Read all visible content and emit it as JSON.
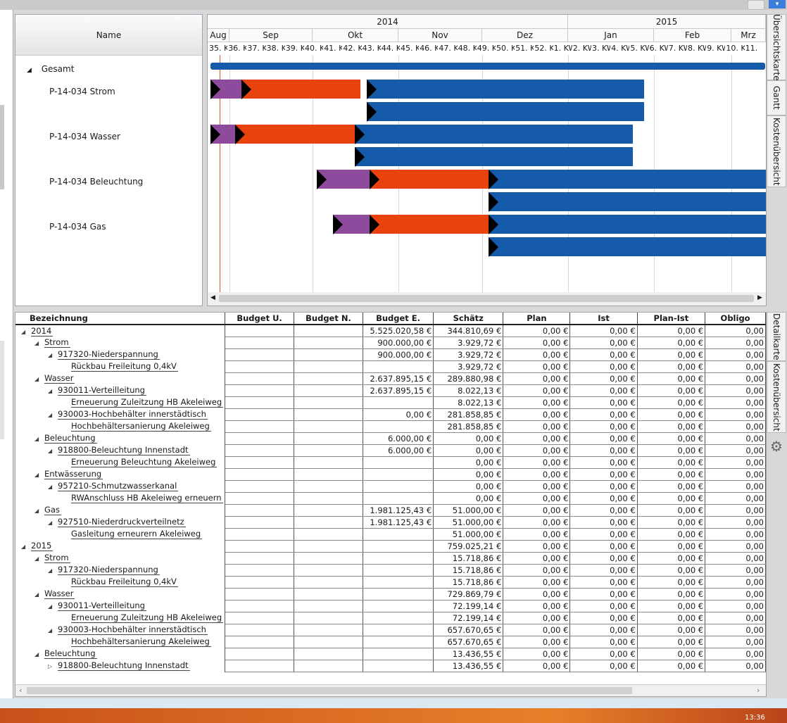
{
  "gantt": {
    "name_header": "Name",
    "years": [
      "2014",
      "2015"
    ],
    "months": [
      "Aug",
      "Sep",
      "Okt",
      "Nov",
      "Dez",
      "Jan",
      "Feb",
      "Mrz"
    ],
    "weeks": [
      "35. K",
      "36. K",
      "37. K",
      "38. K",
      "39. K",
      "40. K",
      "41. K",
      "42. K",
      "43. K",
      "44. K",
      "45. K",
      "46. K",
      "47. K",
      "48. K",
      "49. K",
      "50. K",
      "51. K",
      "52. K",
      "1. KW",
      "2. KW",
      "3. KW",
      "4. KW",
      "5. KW",
      "6. KW",
      "7. KW",
      "8. KW",
      "9. KW",
      "10. K",
      "11."
    ],
    "tree": [
      {
        "label": "Gesamt"
      },
      {
        "label": "P-14-034 Strom"
      },
      {
        "label": "P-14-034 Wasser"
      },
      {
        "label": "P-14-034 Beleuchtung"
      },
      {
        "label": "P-14-034 Gas"
      }
    ],
    "colors": {
      "purple": "#8e4a9d",
      "orange": "#e8420e",
      "blue": "#165aaa",
      "today": "#e05a10"
    }
  },
  "side_tabs_top": [
    "Übersichtskarte",
    "Gantt",
    "Kostenübersicht"
  ],
  "side_tabs_bottom": [
    "Detailkarte",
    "Kostenübersicht"
  ],
  "table": {
    "columns": [
      "Bezeichnung",
      "Budget U.",
      "Budget N.",
      "Budget E.",
      "Schätz",
      "Plan",
      "Ist",
      "Plan-Ist",
      "Obligo"
    ],
    "rows": [
      {
        "level": 0,
        "label": "2014",
        "arrow": "◢",
        "bu": "",
        "bn": "",
        "be": "5.525.020,58 €",
        "s": "344.810,69 €",
        "p": "0,00 €",
        "i": "0,00 €",
        "pi": "0,00 €",
        "o": "0,00"
      },
      {
        "level": 1,
        "label": "Strom",
        "arrow": "◢",
        "bu": "",
        "bn": "",
        "be": "900.000,00 €",
        "s": "3.929,72 €",
        "p": "0,00 €",
        "i": "0,00 €",
        "pi": "0,00 €",
        "o": "0,00"
      },
      {
        "level": 2,
        "label": "917320-Niederspannung",
        "arrow": "◢",
        "bu": "",
        "bn": "",
        "be": "900.000,00 €",
        "s": "3.929,72 €",
        "p": "0,00 €",
        "i": "0,00 €",
        "pi": "0,00 €",
        "o": "0,00"
      },
      {
        "level": 3,
        "label": "Rückbau Freileitung 0,4kV",
        "arrow": "",
        "bu": "",
        "bn": "",
        "be": "",
        "s": "3.929,72 €",
        "p": "0,00 €",
        "i": "0,00 €",
        "pi": "0,00 €",
        "o": "0,00"
      },
      {
        "level": 1,
        "label": "Wasser",
        "arrow": "◢",
        "bu": "",
        "bn": "",
        "be": "2.637.895,15 €",
        "s": "289.880,98 €",
        "p": "0,00 €",
        "i": "0,00 €",
        "pi": "0,00 €",
        "o": "0,00"
      },
      {
        "level": 2,
        "label": "930011-Verteilleitung",
        "arrow": "◢",
        "bu": "",
        "bn": "",
        "be": "2.637.895,15 €",
        "s": "8.022,13 €",
        "p": "0,00 €",
        "i": "0,00 €",
        "pi": "0,00 €",
        "o": "0,00"
      },
      {
        "level": 3,
        "label": "Erneuerung Zuleitzung HB Akeleiweg",
        "arrow": "",
        "bu": "",
        "bn": "",
        "be": "",
        "s": "8.022,13 €",
        "p": "0,00 €",
        "i": "0,00 €",
        "pi": "0,00 €",
        "o": "0,00"
      },
      {
        "level": 2,
        "label": "930003-Hochbehälter innerstädtisch",
        "arrow": "◢",
        "bu": "",
        "bn": "",
        "be": "0,00 €",
        "s": "281.858,85 €",
        "p": "0,00 €",
        "i": "0,00 €",
        "pi": "0,00 €",
        "o": "0,00"
      },
      {
        "level": 3,
        "label": "Hochbehältersanierung Akeleiweg",
        "arrow": "",
        "bu": "",
        "bn": "",
        "be": "",
        "s": "281.858,85 €",
        "p": "0,00 €",
        "i": "0,00 €",
        "pi": "0,00 €",
        "o": "0,00"
      },
      {
        "level": 1,
        "label": "Beleuchtung",
        "arrow": "◢",
        "bu": "",
        "bn": "",
        "be": "6.000,00 €",
        "s": "0,00 €",
        "p": "0,00 €",
        "i": "0,00 €",
        "pi": "0,00 €",
        "o": "0,00"
      },
      {
        "level": 2,
        "label": "918800-Beleuchtung Innenstadt",
        "arrow": "◢",
        "bu": "",
        "bn": "",
        "be": "6.000,00 €",
        "s": "0,00 €",
        "p": "0,00 €",
        "i": "0,00 €",
        "pi": "0,00 €",
        "o": "0,00"
      },
      {
        "level": 3,
        "label": "Erneuerung Beleuchtung Akeleiweg",
        "arrow": "",
        "bu": "",
        "bn": "",
        "be": "",
        "s": "0,00 €",
        "p": "0,00 €",
        "i": "0,00 €",
        "pi": "0,00 €",
        "o": "0,00"
      },
      {
        "level": 1,
        "label": "Entwässerung",
        "arrow": "◢",
        "bu": "",
        "bn": "",
        "be": "",
        "s": "0,00 €",
        "p": "0,00 €",
        "i": "0,00 €",
        "pi": "0,00 €",
        "o": "0,00"
      },
      {
        "level": 2,
        "label": "957210-Schmutzwasserkanal",
        "arrow": "◢",
        "bu": "",
        "bn": "",
        "be": "",
        "s": "0,00 €",
        "p": "0,00 €",
        "i": "0,00 €",
        "pi": "0,00 €",
        "o": "0,00"
      },
      {
        "level": 3,
        "label": "RWAnschluss HB Akeleiweg erneuern",
        "arrow": "",
        "bu": "",
        "bn": "",
        "be": "",
        "s": "0,00 €",
        "p": "0,00 €",
        "i": "0,00 €",
        "pi": "0,00 €",
        "o": "0,00"
      },
      {
        "level": 1,
        "label": "Gas",
        "arrow": "◢",
        "bu": "",
        "bn": "",
        "be": "1.981.125,43 €",
        "s": "51.000,00 €",
        "p": "0,00 €",
        "i": "0,00 €",
        "pi": "0,00 €",
        "o": "0,00"
      },
      {
        "level": 2,
        "label": "927510-Niederdruckverteilnetz",
        "arrow": "◢",
        "bu": "",
        "bn": "",
        "be": "1.981.125,43 €",
        "s": "51.000,00 €",
        "p": "0,00 €",
        "i": "0,00 €",
        "pi": "0,00 €",
        "o": "0,00"
      },
      {
        "level": 3,
        "label": "Gasleitung erneurern Akeleiweg",
        "arrow": "",
        "bu": "",
        "bn": "",
        "be": "",
        "s": "51.000,00 €",
        "p": "0,00 €",
        "i": "0,00 €",
        "pi": "0,00 €",
        "o": "0,00"
      },
      {
        "level": 0,
        "label": "2015",
        "arrow": "◢",
        "bu": "",
        "bn": "",
        "be": "",
        "s": "759.025,21 €",
        "p": "0,00 €",
        "i": "0,00 €",
        "pi": "0,00 €",
        "o": "0,00"
      },
      {
        "level": 1,
        "label": "Strom",
        "arrow": "◢",
        "bu": "",
        "bn": "",
        "be": "",
        "s": "15.718,86 €",
        "p": "0,00 €",
        "i": "0,00 €",
        "pi": "0,00 €",
        "o": "0,00"
      },
      {
        "level": 2,
        "label": "917320-Niederspannung",
        "arrow": "◢",
        "bu": "",
        "bn": "",
        "be": "",
        "s": "15.718,86 €",
        "p": "0,00 €",
        "i": "0,00 €",
        "pi": "0,00 €",
        "o": "0,00"
      },
      {
        "level": 3,
        "label": "Rückbau Freileitung 0,4kV",
        "arrow": "",
        "bu": "",
        "bn": "",
        "be": "",
        "s": "15.718,86 €",
        "p": "0,00 €",
        "i": "0,00 €",
        "pi": "0,00 €",
        "o": "0,00"
      },
      {
        "level": 1,
        "label": "Wasser",
        "arrow": "◢",
        "bu": "",
        "bn": "",
        "be": "",
        "s": "729.869,79 €",
        "p": "0,00 €",
        "i": "0,00 €",
        "pi": "0,00 €",
        "o": "0,00"
      },
      {
        "level": 2,
        "label": "930011-Verteilleitung",
        "arrow": "◢",
        "bu": "",
        "bn": "",
        "be": "",
        "s": "72.199,14 €",
        "p": "0,00 €",
        "i": "0,00 €",
        "pi": "0,00 €",
        "o": "0,00"
      },
      {
        "level": 3,
        "label": "Erneuerung Zuleitzung HB Akeleiweg",
        "arrow": "",
        "bu": "",
        "bn": "",
        "be": "",
        "s": "72.199,14 €",
        "p": "0,00 €",
        "i": "0,00 €",
        "pi": "0,00 €",
        "o": "0,00"
      },
      {
        "level": 2,
        "label": "930003-Hochbehälter innerstädtisch",
        "arrow": "◢",
        "bu": "",
        "bn": "",
        "be": "",
        "s": "657.670,65 €",
        "p": "0,00 €",
        "i": "0,00 €",
        "pi": "0,00 €",
        "o": "0,00"
      },
      {
        "level": 3,
        "label": "Hochbehältersanierung Akeleiweg",
        "arrow": "",
        "bu": "",
        "bn": "",
        "be": "",
        "s": "657.670,65 €",
        "p": "0,00 €",
        "i": "0,00 €",
        "pi": "0,00 €",
        "o": "0,00"
      },
      {
        "level": 1,
        "label": "Beleuchtung",
        "arrow": "◢",
        "bu": "",
        "bn": "",
        "be": "",
        "s": "13.436,55 €",
        "p": "0,00 €",
        "i": "0,00 €",
        "pi": "0,00 €",
        "o": "0,00"
      },
      {
        "level": 2,
        "label": "918800-Beleuchtung Innenstadt",
        "arrow": "▷",
        "bu": "",
        "bn": "",
        "be": "",
        "s": "13.436,55 €",
        "p": "0,00 €",
        "i": "0,00 €",
        "pi": "0,00 €",
        "o": "0,00"
      }
    ]
  },
  "clock": "13:36"
}
